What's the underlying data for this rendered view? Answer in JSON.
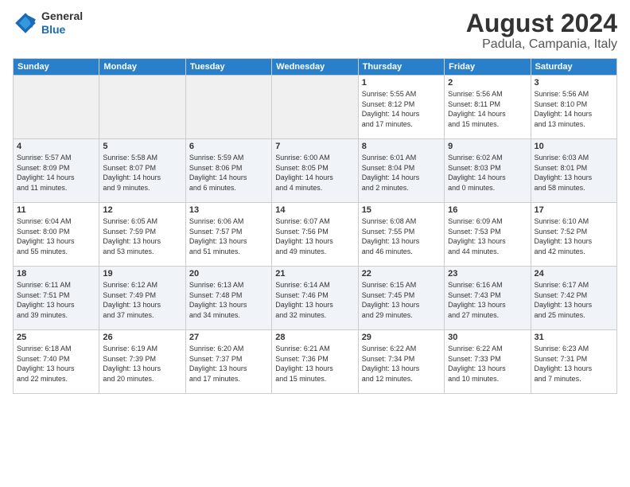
{
  "header": {
    "logo_general": "General",
    "logo_blue": "Blue",
    "title": "August 2024",
    "subtitle": "Padula, Campania, Italy"
  },
  "weekdays": [
    "Sunday",
    "Monday",
    "Tuesday",
    "Wednesday",
    "Thursday",
    "Friday",
    "Saturday"
  ],
  "weeks": [
    [
      {
        "day": "",
        "info": ""
      },
      {
        "day": "",
        "info": ""
      },
      {
        "day": "",
        "info": ""
      },
      {
        "day": "",
        "info": ""
      },
      {
        "day": "1",
        "info": "Sunrise: 5:55 AM\nSunset: 8:12 PM\nDaylight: 14 hours\nand 17 minutes."
      },
      {
        "day": "2",
        "info": "Sunrise: 5:56 AM\nSunset: 8:11 PM\nDaylight: 14 hours\nand 15 minutes."
      },
      {
        "day": "3",
        "info": "Sunrise: 5:56 AM\nSunset: 8:10 PM\nDaylight: 14 hours\nand 13 minutes."
      }
    ],
    [
      {
        "day": "4",
        "info": "Sunrise: 5:57 AM\nSunset: 8:09 PM\nDaylight: 14 hours\nand 11 minutes."
      },
      {
        "day": "5",
        "info": "Sunrise: 5:58 AM\nSunset: 8:07 PM\nDaylight: 14 hours\nand 9 minutes."
      },
      {
        "day": "6",
        "info": "Sunrise: 5:59 AM\nSunset: 8:06 PM\nDaylight: 14 hours\nand 6 minutes."
      },
      {
        "day": "7",
        "info": "Sunrise: 6:00 AM\nSunset: 8:05 PM\nDaylight: 14 hours\nand 4 minutes."
      },
      {
        "day": "8",
        "info": "Sunrise: 6:01 AM\nSunset: 8:04 PM\nDaylight: 14 hours\nand 2 minutes."
      },
      {
        "day": "9",
        "info": "Sunrise: 6:02 AM\nSunset: 8:03 PM\nDaylight: 14 hours\nand 0 minutes."
      },
      {
        "day": "10",
        "info": "Sunrise: 6:03 AM\nSunset: 8:01 PM\nDaylight: 13 hours\nand 58 minutes."
      }
    ],
    [
      {
        "day": "11",
        "info": "Sunrise: 6:04 AM\nSunset: 8:00 PM\nDaylight: 13 hours\nand 55 minutes."
      },
      {
        "day": "12",
        "info": "Sunrise: 6:05 AM\nSunset: 7:59 PM\nDaylight: 13 hours\nand 53 minutes."
      },
      {
        "day": "13",
        "info": "Sunrise: 6:06 AM\nSunset: 7:57 PM\nDaylight: 13 hours\nand 51 minutes."
      },
      {
        "day": "14",
        "info": "Sunrise: 6:07 AM\nSunset: 7:56 PM\nDaylight: 13 hours\nand 49 minutes."
      },
      {
        "day": "15",
        "info": "Sunrise: 6:08 AM\nSunset: 7:55 PM\nDaylight: 13 hours\nand 46 minutes."
      },
      {
        "day": "16",
        "info": "Sunrise: 6:09 AM\nSunset: 7:53 PM\nDaylight: 13 hours\nand 44 minutes."
      },
      {
        "day": "17",
        "info": "Sunrise: 6:10 AM\nSunset: 7:52 PM\nDaylight: 13 hours\nand 42 minutes."
      }
    ],
    [
      {
        "day": "18",
        "info": "Sunrise: 6:11 AM\nSunset: 7:51 PM\nDaylight: 13 hours\nand 39 minutes."
      },
      {
        "day": "19",
        "info": "Sunrise: 6:12 AM\nSunset: 7:49 PM\nDaylight: 13 hours\nand 37 minutes."
      },
      {
        "day": "20",
        "info": "Sunrise: 6:13 AM\nSunset: 7:48 PM\nDaylight: 13 hours\nand 34 minutes."
      },
      {
        "day": "21",
        "info": "Sunrise: 6:14 AM\nSunset: 7:46 PM\nDaylight: 13 hours\nand 32 minutes."
      },
      {
        "day": "22",
        "info": "Sunrise: 6:15 AM\nSunset: 7:45 PM\nDaylight: 13 hours\nand 29 minutes."
      },
      {
        "day": "23",
        "info": "Sunrise: 6:16 AM\nSunset: 7:43 PM\nDaylight: 13 hours\nand 27 minutes."
      },
      {
        "day": "24",
        "info": "Sunrise: 6:17 AM\nSunset: 7:42 PM\nDaylight: 13 hours\nand 25 minutes."
      }
    ],
    [
      {
        "day": "25",
        "info": "Sunrise: 6:18 AM\nSunset: 7:40 PM\nDaylight: 13 hours\nand 22 minutes."
      },
      {
        "day": "26",
        "info": "Sunrise: 6:19 AM\nSunset: 7:39 PM\nDaylight: 13 hours\nand 20 minutes."
      },
      {
        "day": "27",
        "info": "Sunrise: 6:20 AM\nSunset: 7:37 PM\nDaylight: 13 hours\nand 17 minutes."
      },
      {
        "day": "28",
        "info": "Sunrise: 6:21 AM\nSunset: 7:36 PM\nDaylight: 13 hours\nand 15 minutes."
      },
      {
        "day": "29",
        "info": "Sunrise: 6:22 AM\nSunset: 7:34 PM\nDaylight: 13 hours\nand 12 minutes."
      },
      {
        "day": "30",
        "info": "Sunrise: 6:22 AM\nSunset: 7:33 PM\nDaylight: 13 hours\nand 10 minutes."
      },
      {
        "day": "31",
        "info": "Sunrise: 6:23 AM\nSunset: 7:31 PM\nDaylight: 13 hours\nand 7 minutes."
      }
    ]
  ]
}
